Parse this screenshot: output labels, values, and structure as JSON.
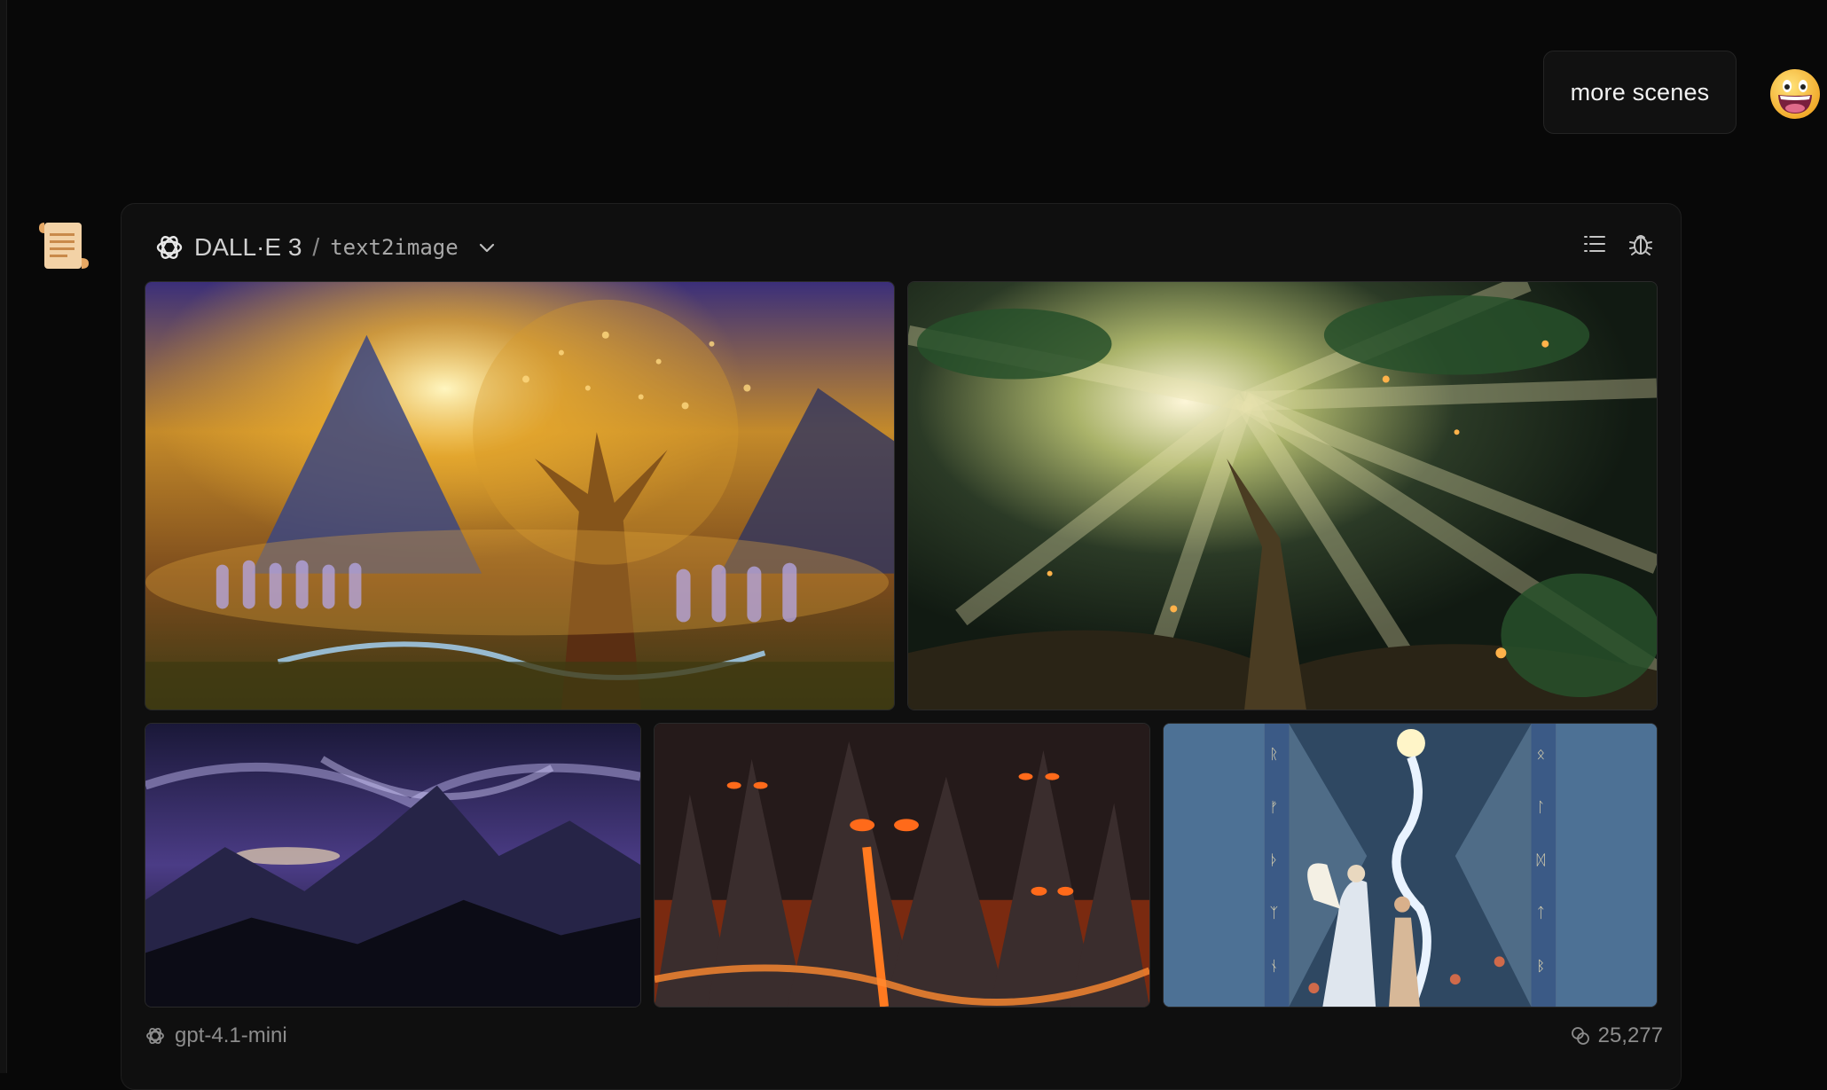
{
  "user_message": {
    "text": "more scenes"
  },
  "assistant": {
    "avatar_icon": "scroll-icon",
    "card": {
      "model": "DALL·E 3",
      "separator": "/",
      "task": "text2image",
      "images": [
        {
          "alt": "Golden tree of life with mountains, sun, and procession of glowing figures"
        },
        {
          "alt": "Sun rays bursting through a giant ancient tree canopy with fireflies"
        },
        {
          "alt": "Purple storm clouds swirling over dark mountain ridges"
        },
        {
          "alt": "Volcanic landscape with demonic faces and flowing lava"
        },
        {
          "alt": "Illustrated angel guiding a figure along a glowing path framed with runes"
        }
      ],
      "footer_model": "gpt-4.1-mini",
      "token_count": "25,277"
    }
  },
  "colors": {
    "background": "#080808",
    "card": "#0f0f0f",
    "muted_text": "#8c8c8c"
  }
}
